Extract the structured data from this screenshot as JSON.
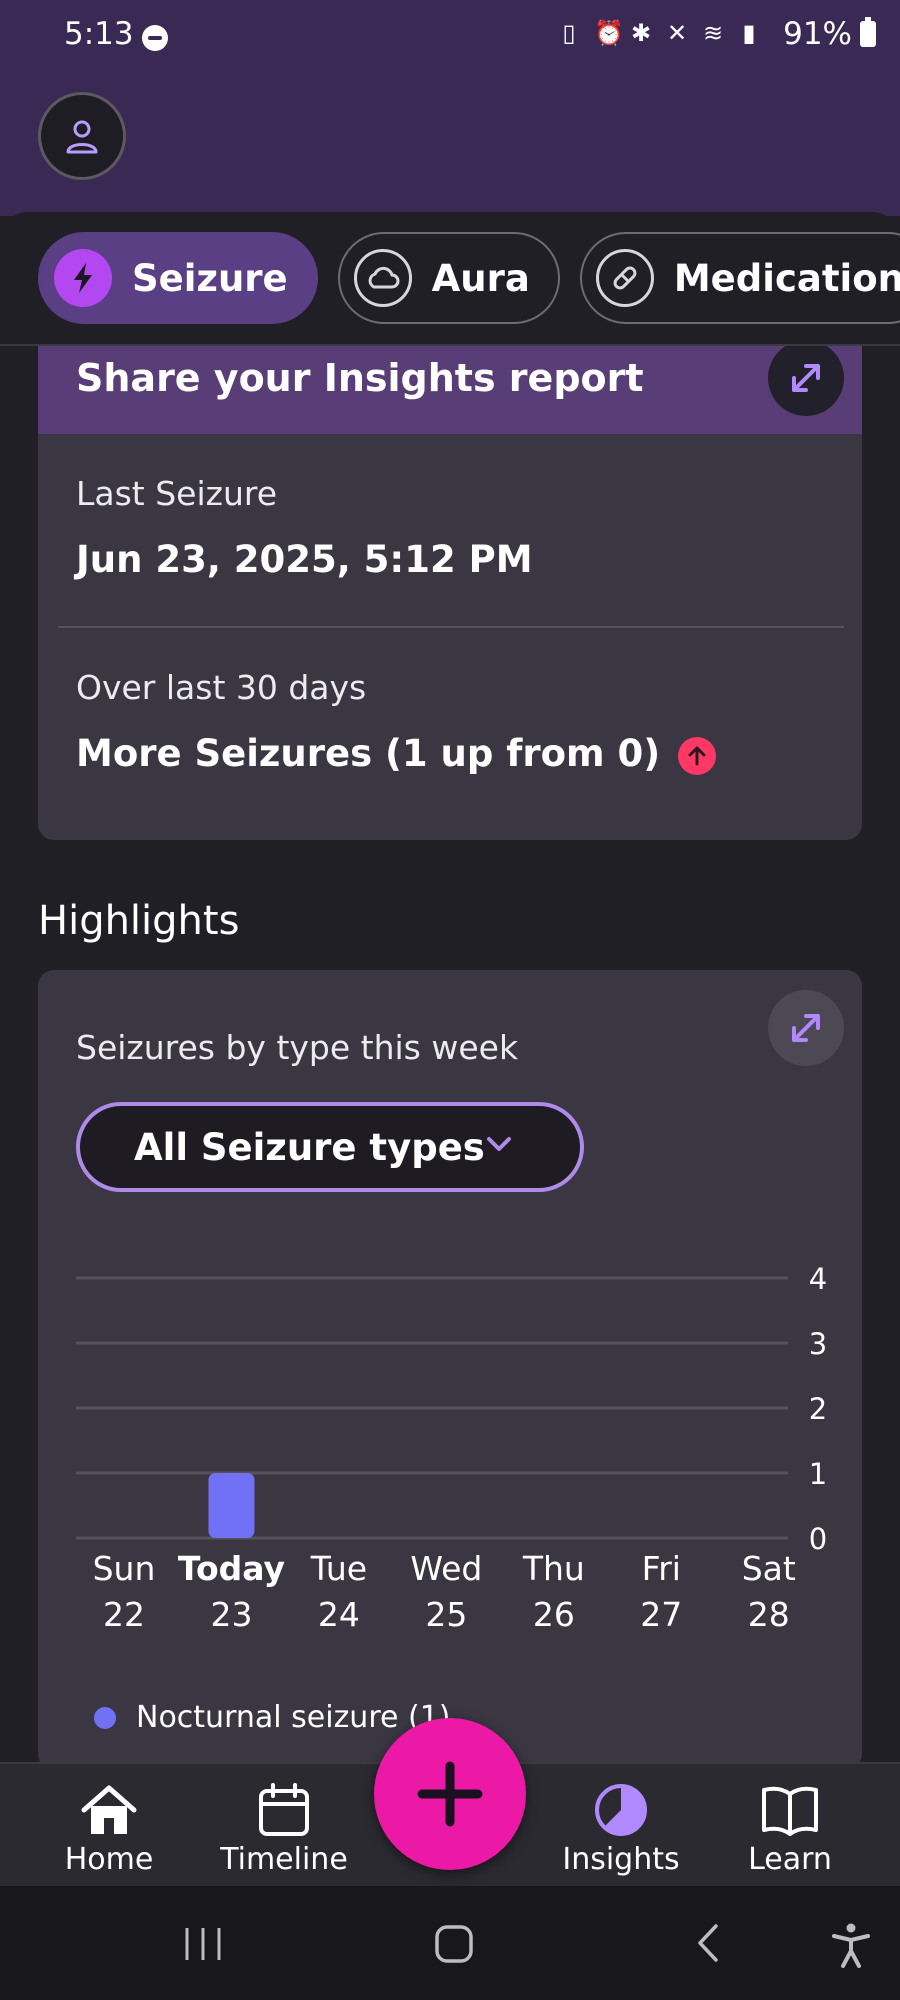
{
  "status_bar": {
    "time": "5:13",
    "battery": "91%"
  },
  "tabs": [
    {
      "label": "Seizure",
      "icon": "bolt-icon",
      "active": true
    },
    {
      "label": "Aura",
      "icon": "cloud-icon",
      "active": false
    },
    {
      "label": "Medication",
      "icon": "pill-icon",
      "active": false
    }
  ],
  "insights_card": {
    "title": "Share your Insights report",
    "last_seizure_label": "Last Seizure",
    "last_seizure_value": "Jun 23, 2025, 5:12 PM",
    "period_label": "Over last 30 days",
    "period_value": "More Seizures (1 up from 0)"
  },
  "highlights": {
    "title": "Highlights",
    "chart_title": "Seizures by type this week",
    "dropdown_value": "All Seizure types",
    "legend": [
      {
        "label": "Nocturnal seizure (1)",
        "color": "#7071f5"
      }
    ]
  },
  "chart_data": {
    "type": "bar",
    "categories": [
      {
        "day": "Sun",
        "date": "22"
      },
      {
        "day": "Today",
        "date": "23"
      },
      {
        "day": "Tue",
        "date": "24"
      },
      {
        "day": "Wed",
        "date": "25"
      },
      {
        "day": "Thu",
        "date": "26"
      },
      {
        "day": "Fri",
        "date": "27"
      },
      {
        "day": "Sat",
        "date": "28"
      }
    ],
    "series": [
      {
        "name": "Nocturnal seizure",
        "values": [
          0,
          1,
          0,
          0,
          0,
          0,
          0
        ],
        "color": "#7071f5"
      }
    ],
    "y_ticks": [
      "0",
      "1",
      "2",
      "3",
      "4"
    ],
    "ylim": [
      0,
      4
    ],
    "highlight_category": 1
  },
  "bottom_nav": {
    "items": [
      {
        "label": "Home",
        "icon": "home-icon"
      },
      {
        "label": "Timeline",
        "icon": "calendar-icon"
      },
      {
        "label": "Insights",
        "icon": "pie-chart-icon",
        "active": true
      },
      {
        "label": "Learn",
        "icon": "book-icon"
      }
    ],
    "fab_icon": "plus-icon"
  },
  "colors": {
    "accent": "#b347f0",
    "fab": "#ec18a6",
    "bar": "#7071f5",
    "alert": "#ff3866"
  }
}
